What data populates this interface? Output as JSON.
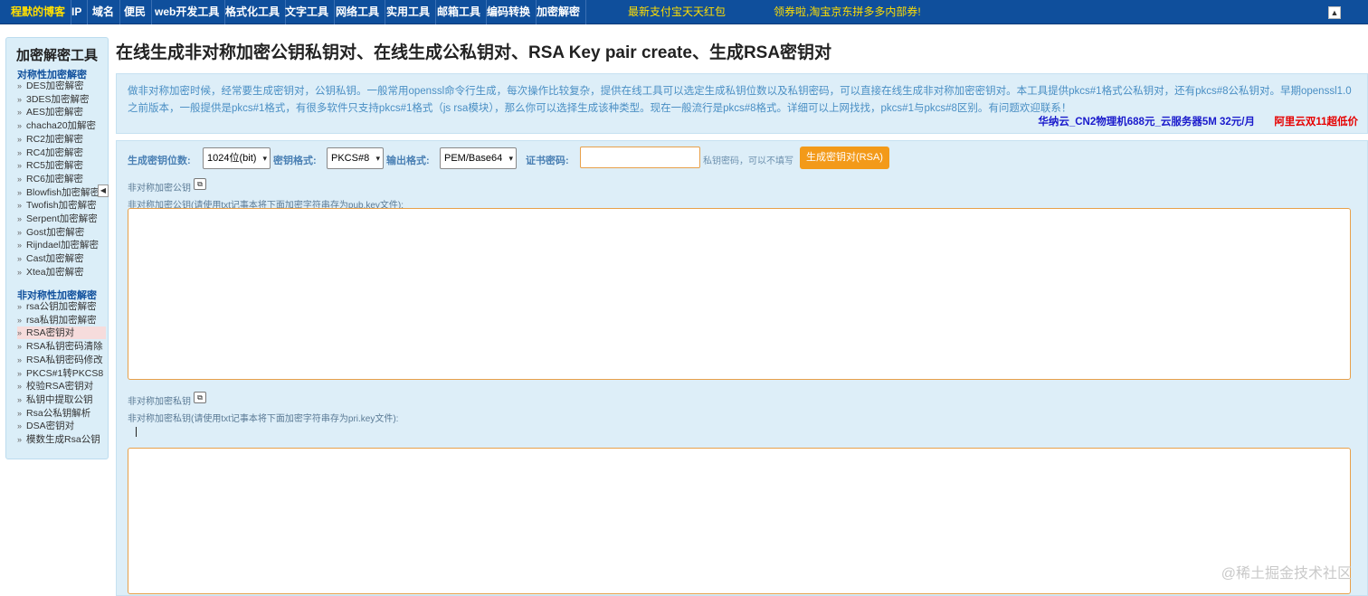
{
  "nav": {
    "items": [
      "程默的博客",
      "IP",
      "域名",
      "便民",
      "web开发工具",
      "格式化工具",
      "文字工具",
      "网络工具",
      "实用工具",
      "邮箱工具",
      "编码转换",
      "加密解密"
    ],
    "promo1": "最新支付宝天天红包",
    "promo2": "领券啦,淘宝京东拼多多内部券!",
    "toggle_icon": "▲"
  },
  "sidebar": {
    "title": "加密解密工具",
    "section_sym": "对称性加密解密",
    "sym_items": [
      "DES加密解密",
      "3DES加密解密",
      "AES加密解密",
      "chacha20加解密",
      "RC2加密解密",
      "RC4加密解密",
      "RC5加密解密",
      "RC6加密解密",
      "Blowfish加密解密",
      "Twofish加密解密",
      "Serpent加密解密",
      "Gost加密解密",
      "Rijndael加密解密",
      "Cast加密解密",
      "Xtea加密解密"
    ],
    "section_asym": "非对称性加密解密",
    "asym_items": [
      "rsa公钥加密解密",
      "rsa私钥加密解密",
      "RSA密钥对",
      "RSA私钥密码清除",
      "RSA私钥密码修改",
      "PKCS#1转PKCS8",
      "校验RSA密钥对",
      "私钥中提取公钥",
      "Rsa公私钥解析",
      "DSA密钥对",
      "模数生成Rsa公钥"
    ],
    "active_item": "RSA密钥对",
    "collapse_icon": "◀"
  },
  "page": {
    "title": "在线生成非对称加密公钥私钥对、在线生成公私钥对、RSA Key pair create、生成RSA密钥对",
    "description": "做非对称加密时候，经常要生成密钥对，公钥私钥。一般常用openssl命令行生成，每次操作比较复杂，提供在线工具可以选定生成私钥位数以及私钥密码，可以直接在线生成非对称加密密钥对。本工具提供pkcs#1格式公私钥对，还有pkcs#8公私钥对。早期openssl1.0之前版本，一般提供是pkcs#1格式，有很多软件只支持pkcs#1格式（js rsa模块），那么你可以选择生成该种类型。现在一般流行是pkcs#8格式。详细可以上网找找，pkcs#1与pkcs#8区别。有问题欢迎联系！",
    "ad_left": "华纳云_CN2物理机688元_云服务器5M 32元/月",
    "ad_right": "阿里云双11超低价"
  },
  "tool": {
    "bits_label": "生成密钥位数:",
    "bits_value": "1024位(bit)",
    "format_label": "密钥格式:",
    "format_value": "PKCS#8",
    "output_label": "输出格式:",
    "output_value": "PEM/Base64",
    "password_label": "证书密码:",
    "password_value": "",
    "password_hint": "私钥密码，可以不填写",
    "generate_button": "生成密钥对(RSA)",
    "pub_label": "非对称加密公钥",
    "pub_desc": "非对称加密公钥(请使用txt记事本将下面加密字符串存为pub.key文件):",
    "pub_value": "",
    "priv_label": "非对称加密私钥",
    "priv_desc": "非对称加密私钥(请使用txt记事本将下面加密字符串存为pri.key文件):",
    "priv_value": "",
    "caret_icon": "▾",
    "copy_icon": "⧉"
  },
  "watermark": "@稀土掘金技术社区"
}
